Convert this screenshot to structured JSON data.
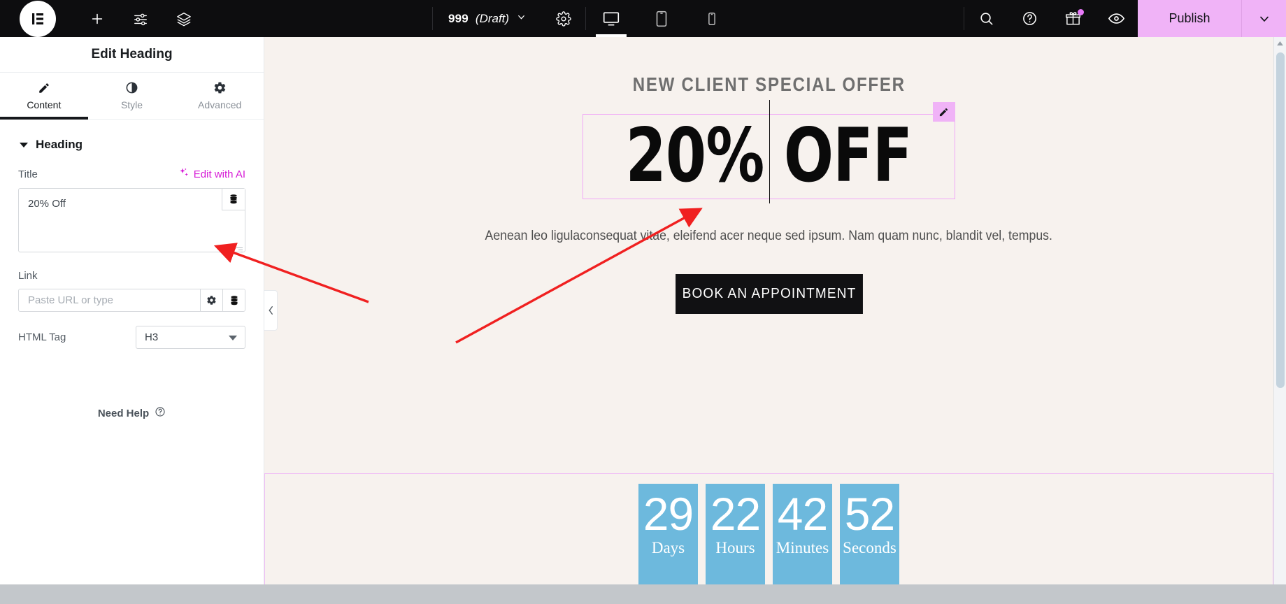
{
  "topbar": {
    "logo_icon": "elementor-logo-icon",
    "add_icon": "plus-icon",
    "settings_sliders_icon": "sliders-icon",
    "layers_icon": "layers-icon",
    "document_id": "999",
    "document_status": "(Draft)",
    "document_caret_icon": "chevron-down-icon",
    "page_settings_icon": "gear-icon",
    "devices": [
      {
        "name": "desktop",
        "icon": "desktop-icon",
        "active": true
      },
      {
        "name": "tablet",
        "icon": "tablet-icon",
        "active": false
      },
      {
        "name": "mobile",
        "icon": "mobile-icon",
        "active": false
      }
    ],
    "search_icon": "search-icon",
    "help_icon": "question-circle-icon",
    "gift_icon": "gift-icon",
    "preview_icon": "eye-icon",
    "publish_label": "Publish",
    "publish_caret_icon": "chevron-down-icon",
    "publish_color": "#f0b3f7"
  },
  "panel": {
    "title": "Edit Heading",
    "tabs": [
      {
        "label": "Content",
        "icon": "pencil-icon",
        "active": true
      },
      {
        "label": "Style",
        "icon": "contrast-circle-icon",
        "active": false
      },
      {
        "label": "Advanced",
        "icon": "gear-icon",
        "active": false
      }
    ],
    "section": {
      "label": "Heading",
      "caret_icon": "caret-down-icon"
    },
    "title_field": {
      "label": "Title",
      "ai_label": "Edit with AI",
      "ai_icon": "sparkles-icon",
      "ai_color": "#d61ad6",
      "value": "20% Off",
      "dynamic_tag_icon": "database-icon"
    },
    "link_field": {
      "label": "Link",
      "placeholder": "Paste URL or type",
      "value": "",
      "options_icon": "gear-icon",
      "dynamic_tag_icon": "database-icon"
    },
    "html_tag_field": {
      "label": "HTML Tag",
      "value": "H3",
      "caret_icon": "caret-down-icon"
    },
    "need_help": {
      "label": "Need Help",
      "icon": "question-circle-icon"
    },
    "collapse_handle_icon": "chevron-left-icon"
  },
  "canvas": {
    "eyebrow": "NEW CLIENT SPECIAL OFFER",
    "headline": "20% OFF",
    "headline_edit_icon": "pencil-icon",
    "selection_color": "#f0a8f7",
    "paragraph": "Aenean leo ligulaconsequat vitae, eleifend acer neque sed ipsum. Nam quam nunc, blandit vel, tempus.",
    "cta_label": "BOOK AN APPOINTMENT",
    "background_color": "#f7f2ee",
    "countdown": {
      "box_color": "#6db9dd",
      "items": [
        {
          "value": "29",
          "label": "Days"
        },
        {
          "value": "22",
          "label": "Hours"
        },
        {
          "value": "42",
          "label": "Minutes"
        },
        {
          "value": "52",
          "label": "Seconds"
        }
      ]
    }
  },
  "scrollbar": {
    "up_arrow_icon": "chevron-up-icon"
  },
  "annotations": {
    "arrow_color": "#f02020",
    "arrows": [
      {
        "name": "arrow-to-title-input"
      },
      {
        "name": "arrow-to-headline"
      }
    ]
  }
}
